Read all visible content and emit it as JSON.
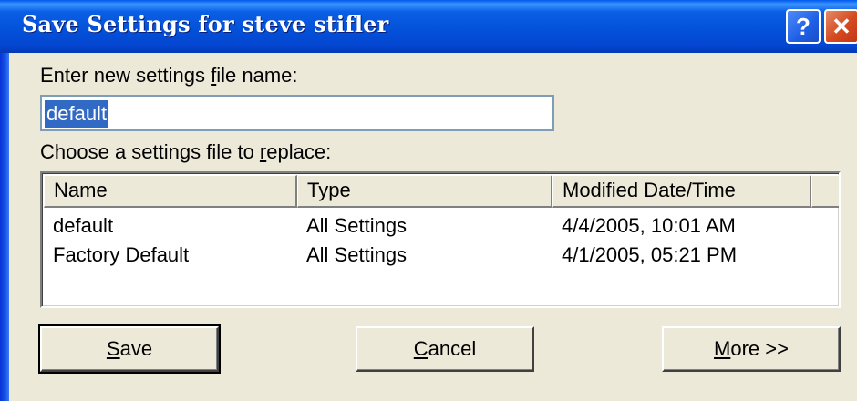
{
  "window": {
    "title": "Save Settings for steve stifler",
    "help_glyph": "?",
    "close_glyph": "✕"
  },
  "name_section": {
    "label_pre": "Enter new settings ",
    "label_accel": "f",
    "label_post": "ile name:",
    "value": "default"
  },
  "replace_section": {
    "label_pre": "Choose a settings file to ",
    "label_accel": "r",
    "label_post": "eplace:"
  },
  "table": {
    "columns": [
      "Name",
      "Type",
      "Modified Date/Time"
    ],
    "rows": [
      {
        "name": "default",
        "type": "All Settings",
        "modified": "4/4/2005, 10:01 AM"
      },
      {
        "name": "Factory Default",
        "type": "All Settings",
        "modified": "4/1/2005, 05:21 PM"
      }
    ]
  },
  "buttons": {
    "save": {
      "accel": "S",
      "rest": "ave"
    },
    "cancel": {
      "accel": "C",
      "rest": "ancel"
    },
    "more": {
      "accel": "M",
      "rest": "ore >>"
    }
  }
}
